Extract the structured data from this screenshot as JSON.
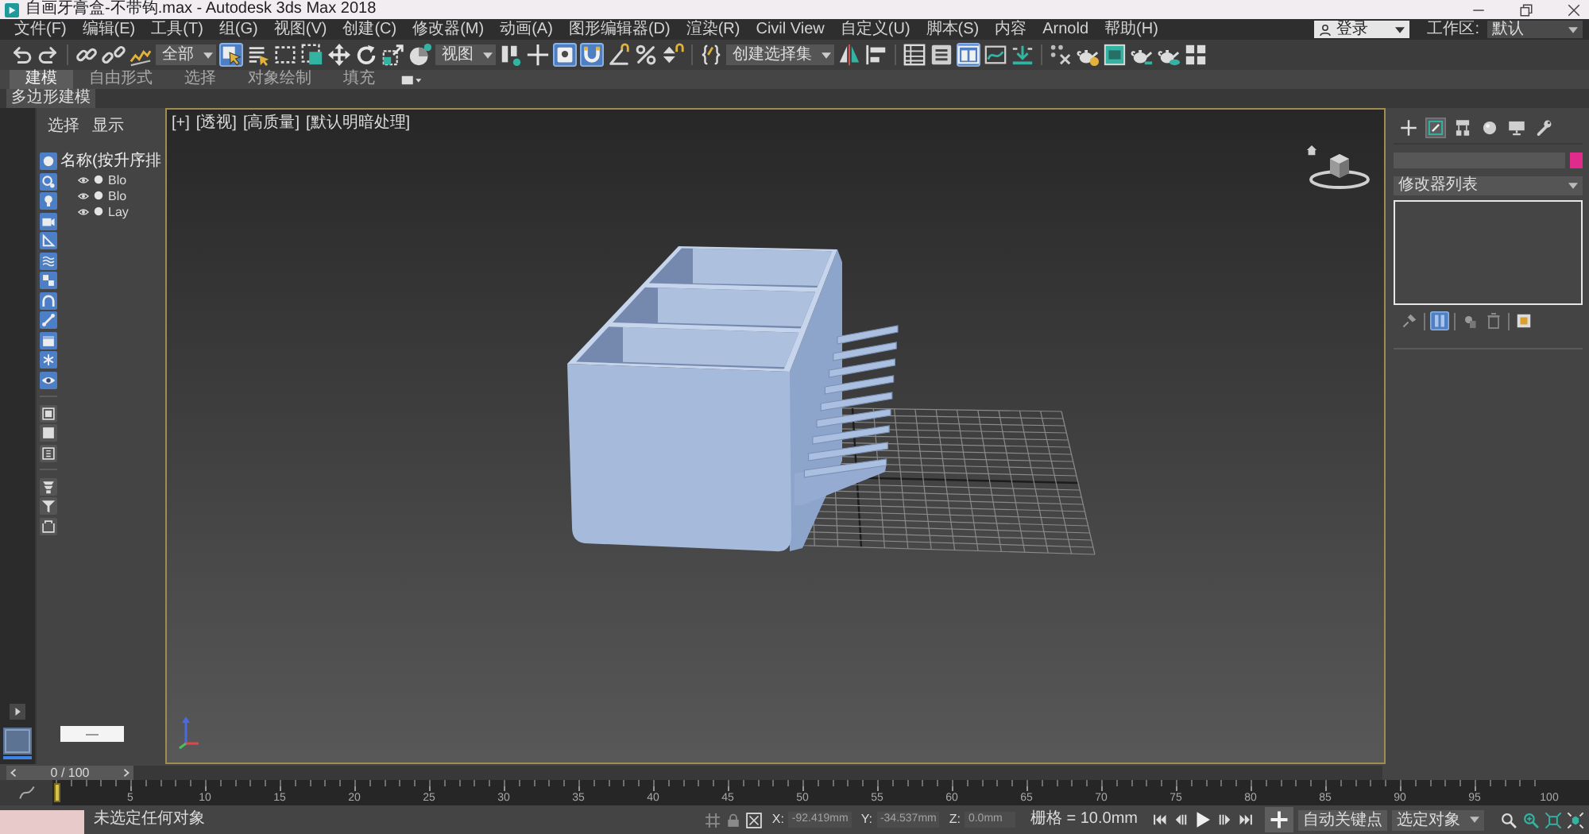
{
  "window": {
    "title": "自画牙膏盒-不带钩.max - Autodesk 3ds Max 2018"
  },
  "menu_bar": {
    "items": [
      "文件(F)",
      "编辑(E)",
      "工具(T)",
      "组(G)",
      "视图(V)",
      "创建(C)",
      "修改器(M)",
      "动画(A)",
      "图形编辑器(D)",
      "渲染(R)",
      "Civil View",
      "自定义(U)",
      "脚本(S)",
      "内容",
      "Arnold",
      "帮助(H)"
    ],
    "login": "登录",
    "workspace": {
      "label": "工作区:",
      "value": "默认"
    }
  },
  "toolbar": {
    "items": [
      {
        "kind": "undo",
        "on": false
      },
      {
        "kind": "redo",
        "on": false
      },
      {
        "kind": "separator"
      },
      {
        "kind": "link",
        "on": false
      },
      {
        "kind": "unlink",
        "on": false
      },
      {
        "kind": "bind",
        "on": false
      },
      {
        "kind": "dropdown",
        "value": "全部"
      },
      {
        "kind": "select",
        "on": true
      },
      {
        "kind": "select_by_name",
        "on": false
      },
      {
        "kind": "rect_select",
        "on": false
      },
      {
        "kind": "window_crossing",
        "on": false
      },
      {
        "kind": "move",
        "on": false
      },
      {
        "kind": "rotate",
        "on": false
      },
      {
        "kind": "scale",
        "on": false
      },
      {
        "kind": "place",
        "on": false
      },
      {
        "kind": "dropdown",
        "value": "视图"
      },
      {
        "kind": "pivot",
        "on": false
      },
      {
        "kind": "manipulate",
        "on": false
      },
      {
        "kind": "keyboard",
        "on": true
      },
      {
        "kind": "snap",
        "on": true
      },
      {
        "kind": "angle_snap",
        "on": false
      },
      {
        "kind": "percent_snap",
        "on": false
      },
      {
        "kind": "spinner_snap",
        "on": false
      },
      {
        "kind": "separator"
      },
      {
        "kind": "named_sets",
        "on": false
      },
      {
        "kind": "dropdown",
        "value": "创建选择集"
      },
      {
        "kind": "mirror",
        "on": false
      },
      {
        "kind": "align",
        "on": false
      },
      {
        "kind": "separator"
      },
      {
        "kind": "scene_explorer",
        "on": false
      },
      {
        "kind": "layer_explorer",
        "on": false
      },
      {
        "kind": "ribbon",
        "on": true
      },
      {
        "kind": "curve_editor",
        "on": false
      },
      {
        "kind": "schematic",
        "on": false
      },
      {
        "kind": "separator"
      },
      {
        "kind": "material",
        "on": false
      },
      {
        "kind": "render_setup",
        "on": false
      },
      {
        "kind": "frame_window",
        "on": false
      },
      {
        "kind": "render",
        "on": false
      },
      {
        "kind": "render_cloud",
        "on": false
      },
      {
        "kind": "quad_grid",
        "on": false
      }
    ]
  },
  "ribbon": {
    "tabs": [
      {
        "label": "建模",
        "selected": true
      },
      {
        "label": "自由形式",
        "selected": false
      },
      {
        "label": "选择",
        "selected": false
      },
      {
        "label": "对象绘制",
        "selected": false
      },
      {
        "label": "填充",
        "selected": false
      }
    ],
    "panel_label": "多边形建模"
  },
  "scene_explorer": {
    "menu": [
      "选择",
      "显示"
    ],
    "filters": [
      {
        "kind": "geometry",
        "on": true
      },
      {
        "kind": "shapes",
        "on": true
      },
      {
        "kind": "lights",
        "on": true
      },
      {
        "kind": "cameras",
        "on": true
      },
      {
        "kind": "helpers",
        "on": true
      },
      {
        "kind": "space_warps",
        "on": true
      },
      {
        "kind": "groups",
        "on": true
      },
      {
        "kind": "xrefs",
        "on": true
      },
      {
        "kind": "bones",
        "on": true
      },
      {
        "kind": "containers",
        "on": true
      },
      {
        "kind": "frozen",
        "on": true
      },
      {
        "kind": "hidden",
        "on": true
      },
      {
        "kind": "separator"
      },
      {
        "kind": "select_all",
        "on": false
      },
      {
        "kind": "select_none",
        "on": false
      },
      {
        "kind": "select_invert",
        "on": false
      },
      {
        "kind": "separator"
      },
      {
        "kind": "display_children",
        "on": false
      },
      {
        "kind": "filter",
        "on": false
      },
      {
        "kind": "options",
        "on": false
      }
    ],
    "column": "名称(按升序排",
    "rows": [
      {
        "name": "Blo",
        "selected": false
      },
      {
        "name": "Blo",
        "selected": false
      },
      {
        "name": "Lay",
        "selected": false
      }
    ]
  },
  "viewport": {
    "labels": [
      "[+]",
      "[透视]",
      "[高质量]",
      "[默认明暗处理]"
    ]
  },
  "command_panel": {
    "tabs": [
      {
        "kind": "create",
        "selected": false
      },
      {
        "kind": "modify",
        "selected": true
      },
      {
        "kind": "hierarchy",
        "selected": false
      },
      {
        "kind": "motion",
        "selected": false
      },
      {
        "kind": "display",
        "selected": false
      },
      {
        "kind": "utilities",
        "selected": false
      }
    ],
    "name_field": {
      "color": "#e02a8c"
    },
    "modifier_list": "修改器列表",
    "stack_tools": [
      {
        "kind": "pin",
        "on": false
      },
      {
        "kind": "separator"
      },
      {
        "kind": "show_end_result",
        "on": true
      },
      {
        "kind": "separator"
      },
      {
        "kind": "make_unique",
        "on": false
      },
      {
        "kind": "remove",
        "on": false
      },
      {
        "kind": "separator"
      },
      {
        "kind": "configure",
        "on": false
      }
    ]
  },
  "time_slider": {
    "label": "0 / 100",
    "level": 0
  },
  "track_bar": {
    "labels": [
      "5",
      "10",
      "15",
      "20",
      "25",
      "30",
      "35",
      "40",
      "45",
      "50",
      "55",
      "60",
      "65",
      "70",
      "75",
      "80",
      "85",
      "90",
      "95",
      "100"
    ]
  },
  "status_bar": {
    "message": "未选定任何对象",
    "coordinates": [
      {
        "label": "X:",
        "value": "-92.419mm",
        "disabled": true
      },
      {
        "label": "Y:",
        "value": "-34.537mm",
        "disabled": true
      },
      {
        "label": "Z:",
        "value": "0.0mm",
        "disabled": true
      }
    ],
    "grid": "栅格 = 10.0mm",
    "auto_key": "自动关键点",
    "key_filter": "选定对象"
  }
}
